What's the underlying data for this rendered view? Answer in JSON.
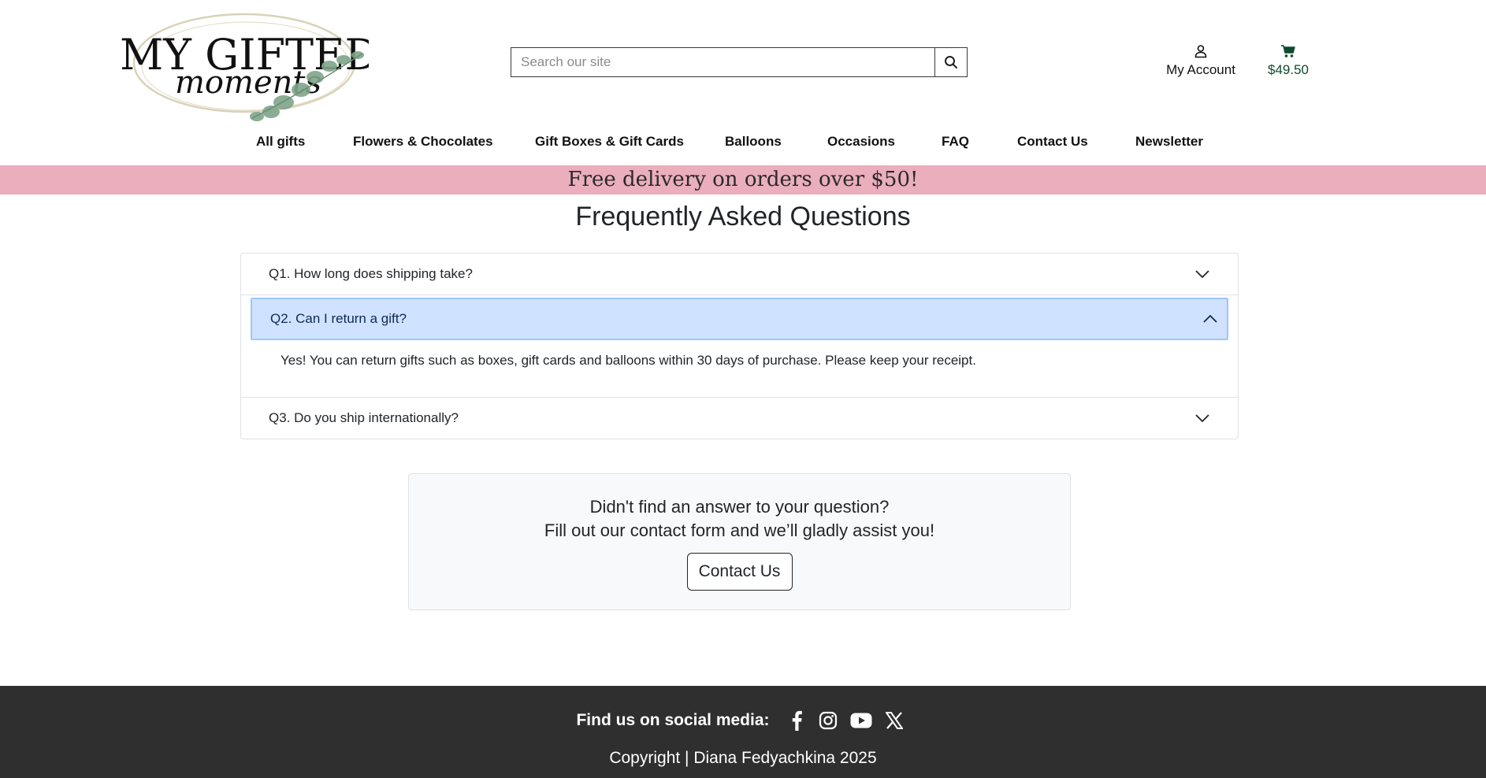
{
  "header": {
    "logo_text_top": "MY GIFTED",
    "logo_text_script": "moments",
    "search_placeholder": "Search our site",
    "account_label": "My Account",
    "cart_total": "$49.50"
  },
  "nav": {
    "items": [
      {
        "label": "All gifts"
      },
      {
        "label": "Flowers & Chocolates"
      },
      {
        "label": "Gift Boxes & Gift Cards"
      },
      {
        "label": "Balloons"
      },
      {
        "label": "Occasions"
      },
      {
        "label": "FAQ"
      },
      {
        "label": "Contact Us"
      },
      {
        "label": "Newsletter"
      }
    ]
  },
  "promo": {
    "text": "Free delivery on orders over $50!"
  },
  "page": {
    "title": "Frequently Asked Questions"
  },
  "faq": {
    "items": [
      {
        "question": "Q1. How long does shipping take?",
        "expanded": false
      },
      {
        "question": "Q2. Can I return a gift?",
        "expanded": true,
        "answer": "Yes! You can return gifts such as boxes, gift cards and balloons within 30 days of purchase. Please keep your receipt."
      },
      {
        "question": "Q3. Do you ship internationally?",
        "expanded": false
      }
    ]
  },
  "contact_box": {
    "line1": "Didn't find an answer to your question?",
    "line2": "Fill out our contact form and we’ll gladly assist you!",
    "button_label": "Contact Us"
  },
  "footer": {
    "social_label": "Find us on social media:",
    "social_icons": [
      "facebook-icon",
      "instagram-icon",
      "youtube-icon",
      "x-icon"
    ],
    "copyright": "Copyright | Diana Fedyachkina 2025"
  },
  "colors": {
    "promo_bg": "#ebaebd",
    "accordion_active_bg": "#cfe2ff",
    "footer_bg": "#2f2f2f",
    "cart_text": "#0d4a2f"
  }
}
